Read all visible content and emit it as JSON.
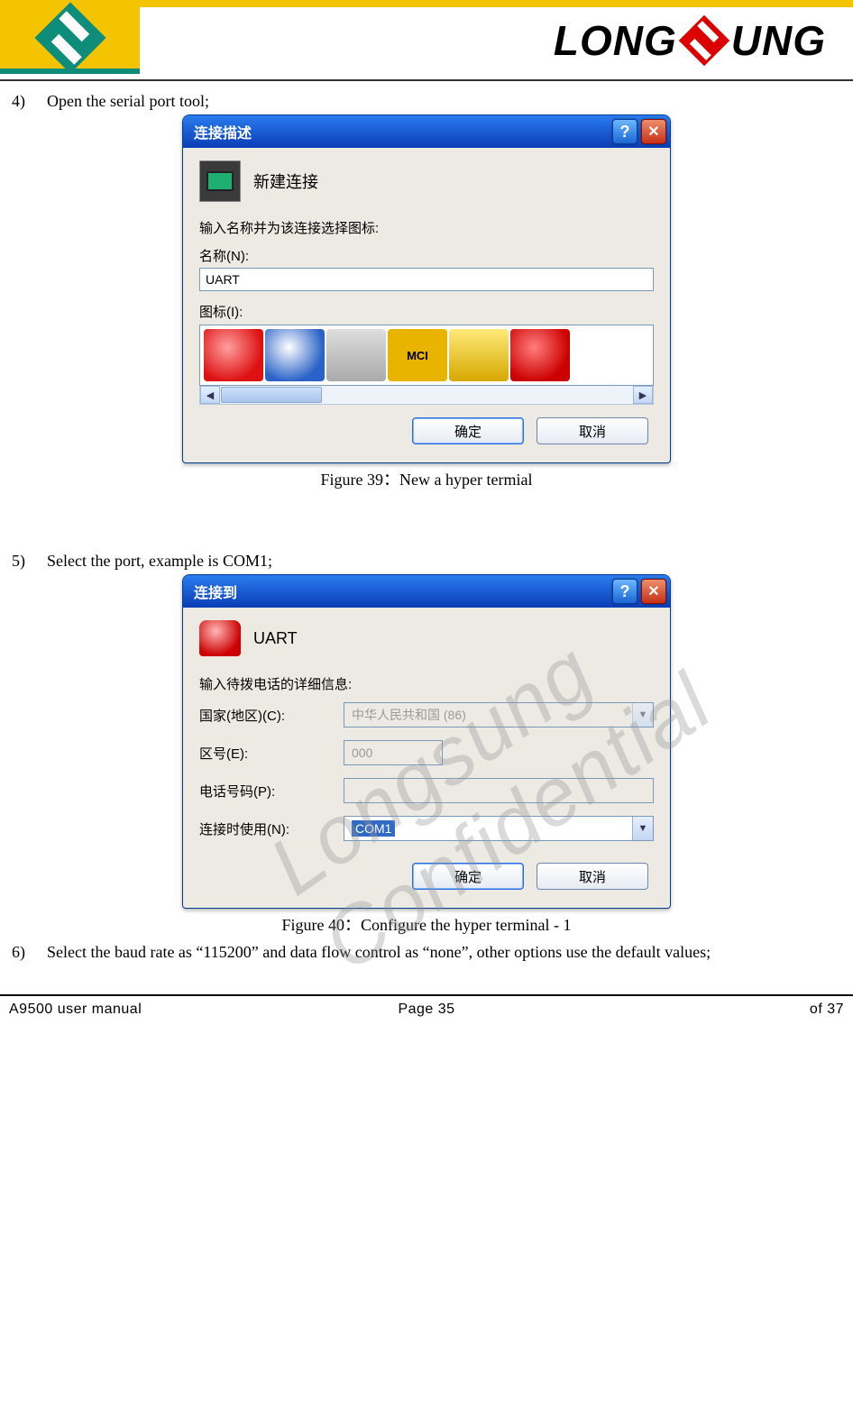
{
  "brand": {
    "part1": "LONG",
    "part2": "UNG"
  },
  "watermark": "Longsung Confidential",
  "steps": {
    "s4": {
      "num": "4)",
      "text": "Open the serial port tool;"
    },
    "s5": {
      "num": "5)",
      "text": "Select the port, example is COM1;"
    },
    "s6": {
      "num": "6)",
      "text": "Select the baud rate as “115200” and data flow control as “none”, other options use the default values;"
    }
  },
  "captions": {
    "fig39": "Figure 39：New a hyper termial",
    "fig40": "Figure 40：Configure the hyper terminal - 1"
  },
  "dialog1": {
    "title": "连接描述",
    "new_connection_label": "新建连接",
    "prompt": "输入名称并为该连接选择图标:",
    "name_label": "名称(N):",
    "name_value": "UART",
    "icon_label": "图标(I):",
    "mci_text": "MCI",
    "ok": "确定",
    "cancel": "取消"
  },
  "dialog2": {
    "title": "连接到",
    "uart_label": "UART",
    "prompt": "输入待拨电话的详细信息:",
    "country_label": "国家(地区)(C):",
    "country_value": "中华人民共和国 (86)",
    "area_label": "区号(E):",
    "area_value": "000",
    "phone_label": "电话号码(P):",
    "phone_value": "",
    "connect_label": "连接时使用(N):",
    "connect_value": "COM1",
    "ok": "确定",
    "cancel": "取消"
  },
  "footer": {
    "left": "A9500 user manual",
    "mid": "Page 35",
    "right": "of 37"
  }
}
